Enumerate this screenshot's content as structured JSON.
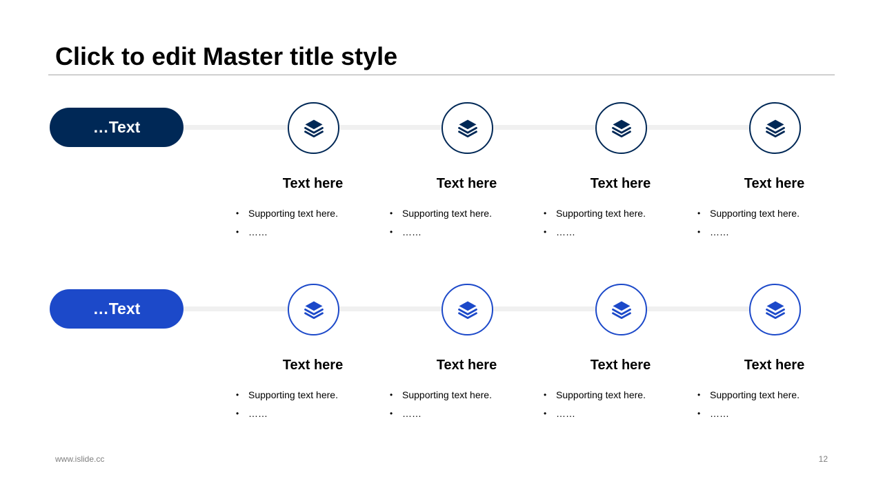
{
  "slide": {
    "title": "Click to edit Master title style",
    "footer_left": "www.islide.cc",
    "page_number": "12"
  },
  "colors": {
    "dark_navy": "#002856",
    "royal_blue": "#1c49c9",
    "connector": "#f0f0f0"
  },
  "rows": [
    {
      "label": "…Text",
      "color": "#002856",
      "steps": [
        {
          "icon": "layers-icon",
          "title": "Text here",
          "bullets": [
            "Supporting text here.",
            "……"
          ]
        },
        {
          "icon": "layers-icon",
          "title": "Text here",
          "bullets": [
            "Supporting text here.",
            "……"
          ]
        },
        {
          "icon": "layers-icon",
          "title": "Text here",
          "bullets": [
            "Supporting text here.",
            "……"
          ]
        },
        {
          "icon": "layers-icon",
          "title": "Text here",
          "bullets": [
            "Supporting text here.",
            "……"
          ]
        }
      ]
    },
    {
      "label": "…Text",
      "color": "#1c49c9",
      "steps": [
        {
          "icon": "layers-icon",
          "title": "Text here",
          "bullets": [
            "Supporting text here.",
            "……"
          ]
        },
        {
          "icon": "layers-icon",
          "title": "Text here",
          "bullets": [
            "Supporting text here.",
            "……"
          ]
        },
        {
          "icon": "layers-icon",
          "title": "Text here",
          "bullets": [
            "Supporting text here.",
            "……"
          ]
        },
        {
          "icon": "layers-icon",
          "title": "Text here",
          "bullets": [
            "Supporting text here.",
            "……"
          ]
        }
      ]
    }
  ]
}
